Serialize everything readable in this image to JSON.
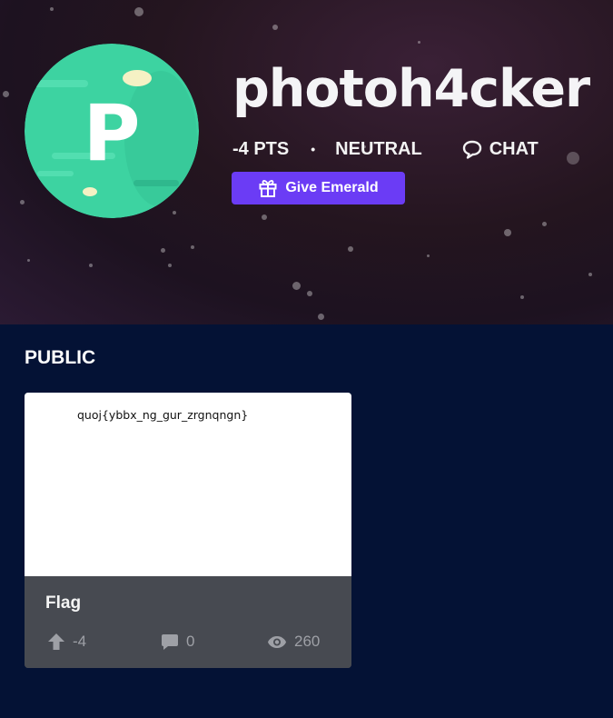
{
  "profile": {
    "username": "photoh4cker",
    "avatar_letter": "P",
    "points": "-4 PTS",
    "separator": "•",
    "status": "NEUTRAL",
    "chat_label": "CHAT",
    "give_button_label": "Give Emerald"
  },
  "section": {
    "title": "PUBLIC"
  },
  "posts": [
    {
      "image_text": "quoj{ybbx_ng_gur_zrgnqngn}",
      "title": "Flag",
      "votes": "-4",
      "comments": "0",
      "views": "260"
    }
  ],
  "colors": {
    "page_background": "#041235",
    "give_button": "#6b3cf5",
    "avatar_green": "#3dd3a1",
    "card_footer": "#474a51",
    "meta_text": "#9ea0a6"
  },
  "icons": {
    "chat": "chat-bubble-icon",
    "gift": "gift-icon",
    "upvote": "upvote-arrow-icon",
    "comment": "comment-icon",
    "views": "eye-icon"
  }
}
